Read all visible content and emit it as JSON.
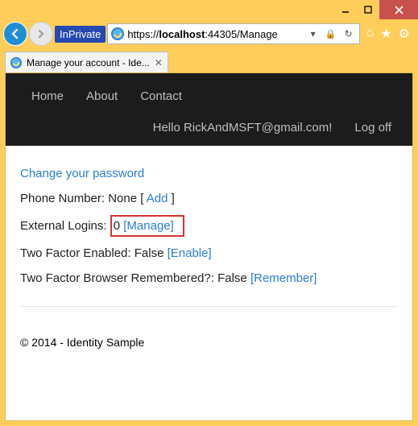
{
  "window": {
    "inprivate_label": "InPrivate",
    "url_prefix": "https://",
    "url_host": "localhost",
    "url_port_path": ":44305/Manage",
    "tab_title": "Manage your account - Ide..."
  },
  "nav": {
    "home": "Home",
    "about": "About",
    "contact": "Contact",
    "greeting": "Hello RickAndMSFT@gmail.com!",
    "logoff": "Log off"
  },
  "page": {
    "change_password": "Change your password",
    "phone_label": "Phone Number: None [ ",
    "phone_add": "Add",
    "phone_close": " ]",
    "ext_label": "External Logins: ",
    "ext_count": "0 ",
    "ext_manage": "[Manage]",
    "tfe_label": "Two Factor Enabled: False ",
    "tfe_link": "[Enable]",
    "tfb_label": "Two Factor Browser Remembered?: False ",
    "tfb_link": "[Remember]"
  },
  "footer": {
    "text": "© 2014 - Identity Sample"
  }
}
